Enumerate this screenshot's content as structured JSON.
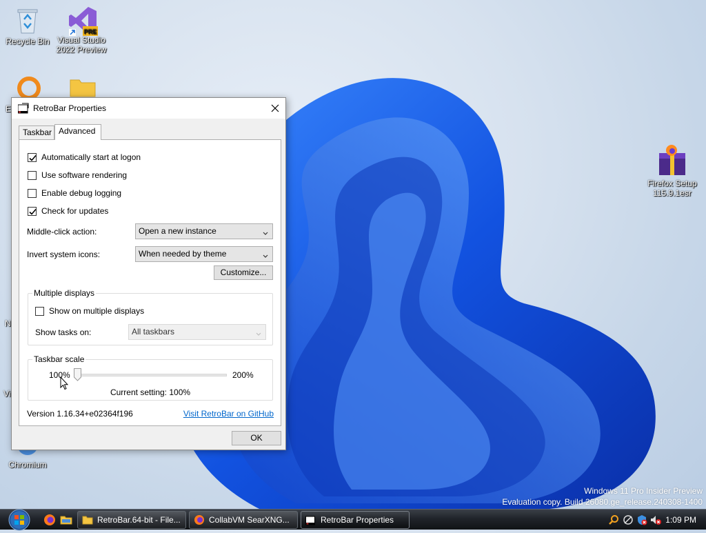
{
  "desktop": {
    "icons": [
      {
        "label": "Recycle Bin"
      },
      {
        "label": "Visual Studio 2022 Preview"
      },
      {
        "label": "Firefox Setup 115.9.1esr"
      },
      {
        "label": "Chromium"
      }
    ],
    "vs_badge": "PRE",
    "partial_labels": [
      "E",
      "N",
      "Vi"
    ]
  },
  "watermark": {
    "line1": "Windows 11 Pro Insider Preview",
    "line2": "Evaluation copy. Build 26080.ge_release.240308-1400"
  },
  "dialog": {
    "title": "RetroBar Properties",
    "tabs": [
      {
        "label": "Taskbar",
        "active": false
      },
      {
        "label": "Advanced",
        "active": true
      }
    ],
    "options": {
      "auto_start": {
        "label": "Automatically start at logon",
        "checked": true
      },
      "software_rendering": {
        "label": "Use software rendering",
        "checked": false
      },
      "debug_logging": {
        "label": "Enable debug logging",
        "checked": false
      },
      "check_updates": {
        "label": "Check for updates",
        "checked": true
      }
    },
    "middle_click": {
      "label": "Middle-click action:",
      "value": "Open a new instance"
    },
    "invert_icons": {
      "label": "Invert system icons:",
      "value": "When needed by theme"
    },
    "customize_label": "Customize...",
    "multiple_displays": {
      "title": "Multiple displays",
      "show_on_multiple": {
        "label": "Show on multiple displays",
        "checked": false
      },
      "show_tasks_label": "Show tasks on:",
      "show_tasks_value": "All taskbars"
    },
    "scale": {
      "title": "Taskbar scale",
      "min_label": "100%",
      "max_label": "200%",
      "value_percent": 100,
      "current": "Current setting: 100%"
    },
    "version": "Version 1.16.34+e02364f196",
    "github_link": "Visit RetroBar on GitHub",
    "ok_label": "OK"
  },
  "taskbar": {
    "tasks": [
      {
        "label": "RetroBar.64-bit - File...",
        "icon": "folder-icon"
      },
      {
        "label": "CollabVM SearXNG...",
        "icon": "firefox-icon"
      },
      {
        "label": "RetroBar Properties",
        "icon": "retrobar-icon",
        "active": true
      }
    ],
    "clock": "1:09 PM"
  },
  "colors": {
    "accent": "#0066cc",
    "wallpaper_blue": "#1a4fd6"
  }
}
